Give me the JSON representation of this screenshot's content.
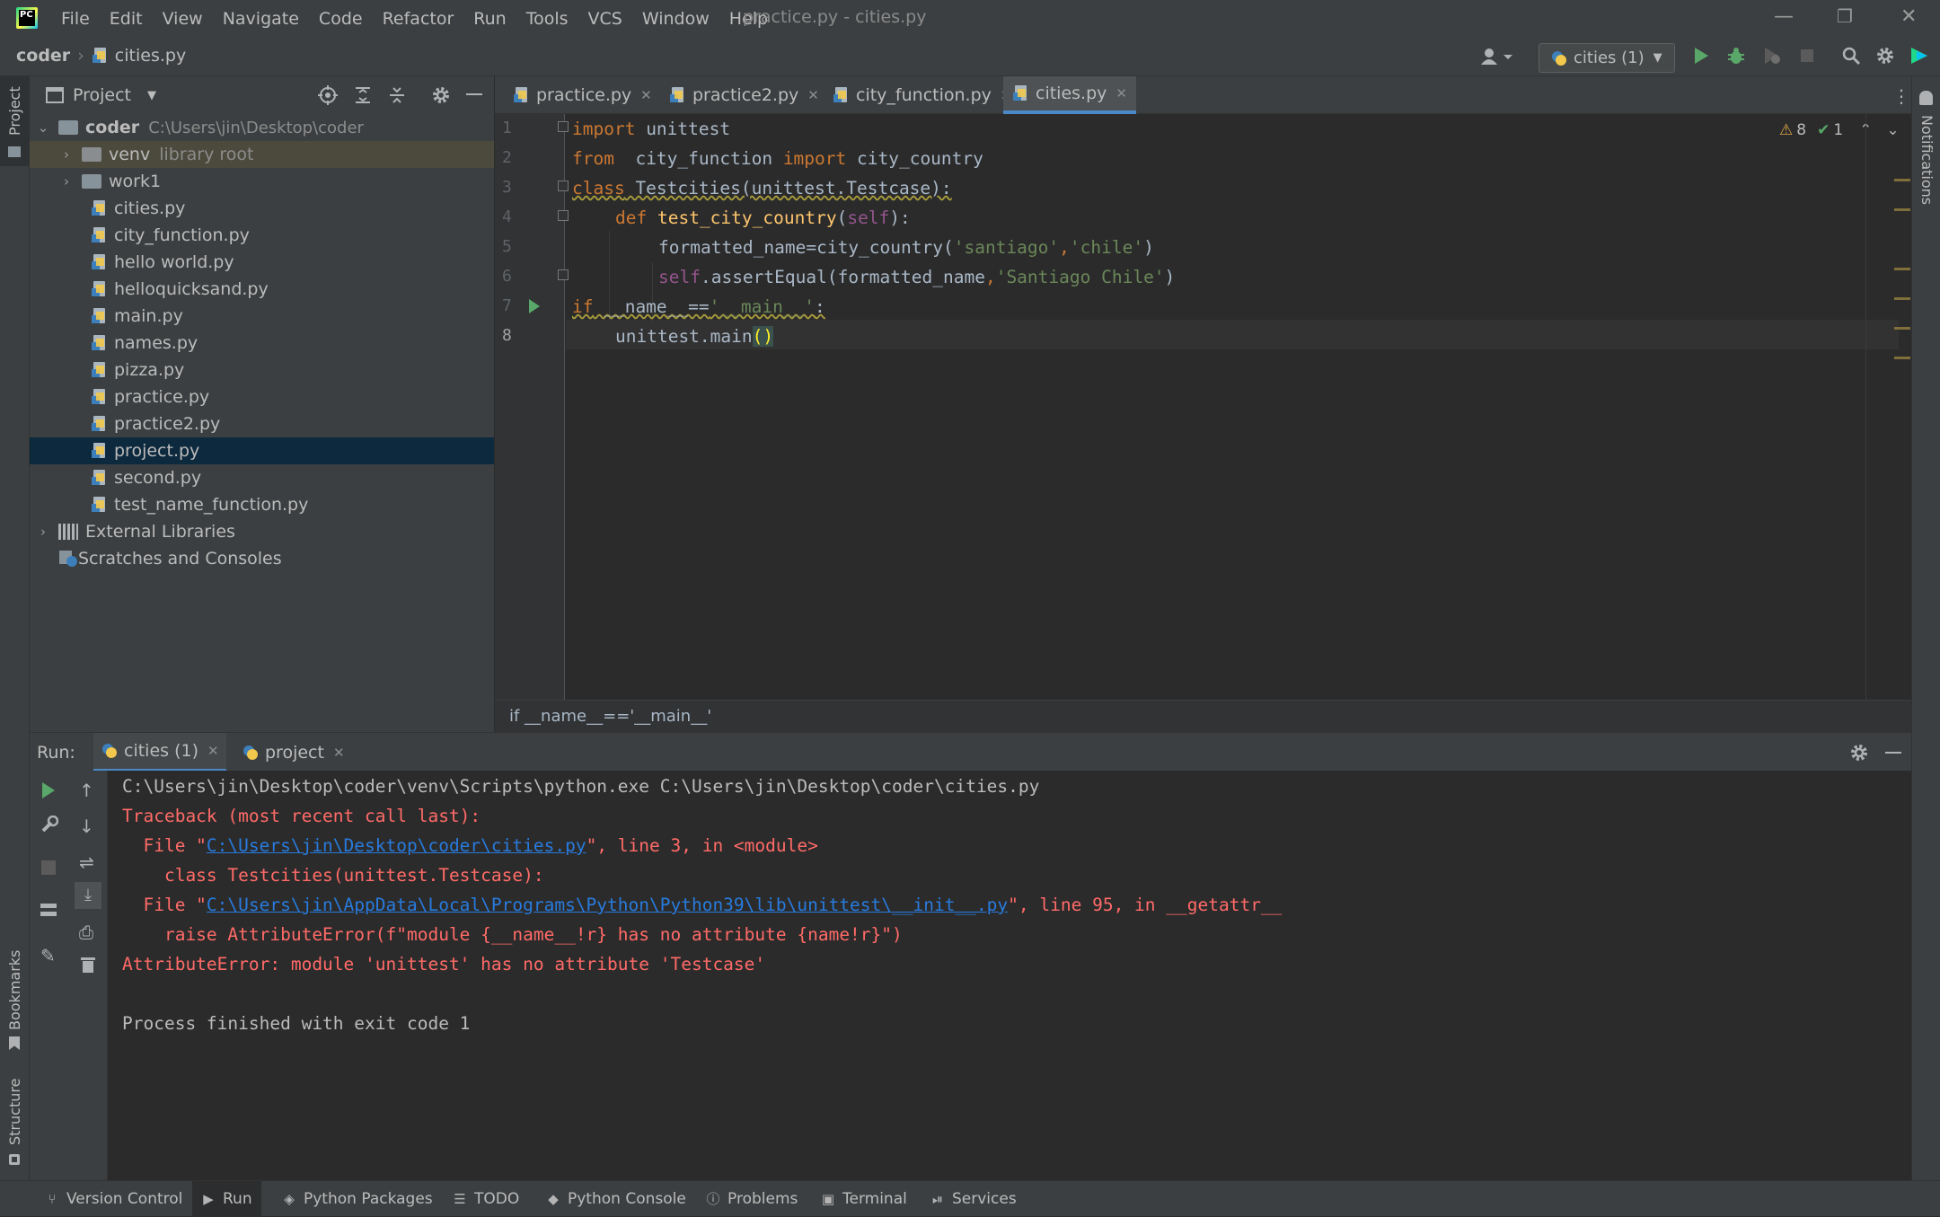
{
  "window": {
    "title": "practice.py - cities.py"
  },
  "menu": [
    "File",
    "Edit",
    "View",
    "Navigate",
    "Code",
    "Refactor",
    "Run",
    "Tools",
    "VCS",
    "Window",
    "Help"
  ],
  "breadcrumb": {
    "project": "coder",
    "file": "cities.py"
  },
  "run_config": "cities (1)",
  "project_panel": {
    "title": "Project",
    "root": {
      "name": "coder",
      "path": "C:\\Users\\jin\\Desktop\\coder"
    },
    "venv": {
      "name": "venv",
      "tag": "library root"
    },
    "work1": "work1",
    "files": [
      "cities.py",
      "city_function.py",
      "hello world.py",
      "helloquicksand.py",
      "main.py",
      "names.py",
      "pizza.py",
      "practice.py",
      "practice2.py",
      "project.py",
      "second.py",
      "test_name_function.py"
    ],
    "external": "External Libraries",
    "scratches": "Scratches and Consoles"
  },
  "left_strip": {
    "project": "Project",
    "bookmarks": "Bookmarks",
    "structure": "Structure"
  },
  "right_strip": {
    "notifications": "Notifications"
  },
  "editor_tabs": [
    "practice.py",
    "practice2.py",
    "city_function.py",
    "cities.py"
  ],
  "inspections": {
    "warnings": "8",
    "ok": "1"
  },
  "code": {
    "line_numbers": [
      "1",
      "2",
      "3",
      "4",
      "5",
      "6",
      "7",
      "8"
    ],
    "l1": [
      "import",
      " unittest"
    ],
    "l2": [
      "from",
      "  city_function ",
      "import",
      " city_country"
    ],
    "l3": [
      "class",
      " Testcities(unittest.Testcase):"
    ],
    "l4": [
      "def",
      " ",
      "test_city_country",
      "(",
      "self",
      "):"
    ],
    "l5": [
      "formatted_name=city_country(",
      "'santiago'",
      ",",
      "'chile'",
      ")"
    ],
    "l6": [
      "self",
      ".assertEqual(formatted_name",
      ",",
      "'Santiago Chile'",
      ")"
    ],
    "l7": [
      "if",
      " __name__==",
      "'__main__'",
      ":"
    ],
    "l8": [
      "unittest.main",
      "()"
    ]
  },
  "editor_breadcrumb": "if __name__=='__main__'",
  "run": {
    "label": "Run:",
    "tabs": [
      "cities (1)",
      "project"
    ],
    "output": {
      "cmd": "C:\\Users\\jin\\Desktop\\coder\\venv\\Scripts\\python.exe C:\\Users\\jin\\Desktop\\coder\\cities.py",
      "tb": "Traceback (most recent call last):",
      "f1_pre": "  File \"",
      "f1_link": "C:\\Users\\jin\\Desktop\\coder\\cities.py",
      "f1_post": "\", line 3, in <module>",
      "f1_code": "    class Testcities(unittest.Testcase):",
      "f2_pre": "  File \"",
      "f2_link": "C:\\Users\\jin\\AppData\\Local\\Programs\\Python\\Python39\\lib\\unittest\\__init__.py",
      "f2_post": "\", line 95, in __getattr__",
      "f2_code": "    raise AttributeError(f\"module {__name__!r} has no attribute {name!r}\")",
      "error": "AttributeError: module 'unittest' has no attribute 'Testcase'",
      "exit": "Process finished with exit code 1"
    }
  },
  "statusbar": [
    "Version Control",
    "Run",
    "Python Packages",
    "TODO",
    "Python Console",
    "Problems",
    "Terminal",
    "Services"
  ]
}
